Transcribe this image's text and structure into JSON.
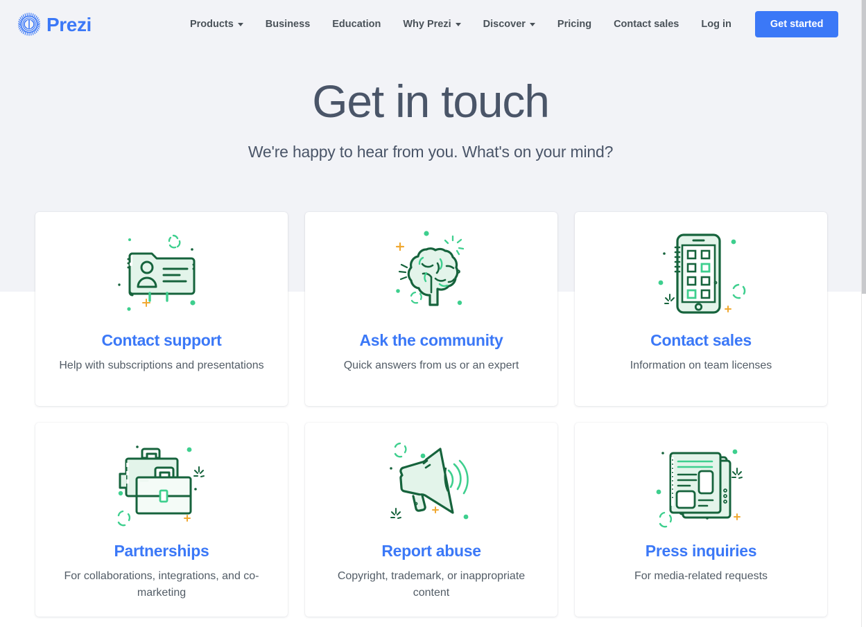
{
  "navbar": {
    "brand": {
      "name": "Prezi",
      "icon": "prezi-sunburst-logo"
    },
    "links": [
      {
        "label": "Products",
        "has_caret": true
      },
      {
        "label": "Business",
        "has_caret": false
      },
      {
        "label": "Education",
        "has_caret": false
      },
      {
        "label": "Why Prezi",
        "has_caret": true
      },
      {
        "label": "Discover",
        "has_caret": true
      },
      {
        "label": "Pricing",
        "has_caret": false
      },
      {
        "label": "Contact sales",
        "has_caret": false
      },
      {
        "label": "Log in",
        "has_caret": false
      }
    ],
    "cta_label": "Get started"
  },
  "hero": {
    "title": "Get in touch",
    "subtitle": "We're happy to hear from you. What's on your mind?"
  },
  "cards": [
    {
      "title": "Contact support",
      "desc": "Help with subscriptions and presentations",
      "icon": "contact-card-folder-icon"
    },
    {
      "title": "Ask the community",
      "desc": "Quick answers from us or an expert",
      "icon": "brain-icon"
    },
    {
      "title": "Contact sales",
      "desc": "Information on team licenses",
      "icon": "tablet-apps-icon"
    },
    {
      "title": "Partnerships",
      "desc": "For collaborations, integrations, and co-marketing",
      "icon": "briefcase-icon"
    },
    {
      "title": "Report abuse",
      "desc": "Copyright, trademark, or inappropriate content",
      "icon": "megaphone-icon"
    },
    {
      "title": "Press inquiries",
      "desc": "For media-related requests",
      "icon": "newspaper-icon"
    }
  ],
  "colors": {
    "accent_blue": "#3b78f7",
    "page_bg_top": "#f2f3f7",
    "page_bg_bottom": "#ffffff",
    "text_dark": "#4a5568",
    "icon_green_dark": "#16633c",
    "icon_green_mid": "#3ecf8e",
    "icon_green_fill": "#e3f4ea",
    "icon_orange": "#f0a830"
  }
}
